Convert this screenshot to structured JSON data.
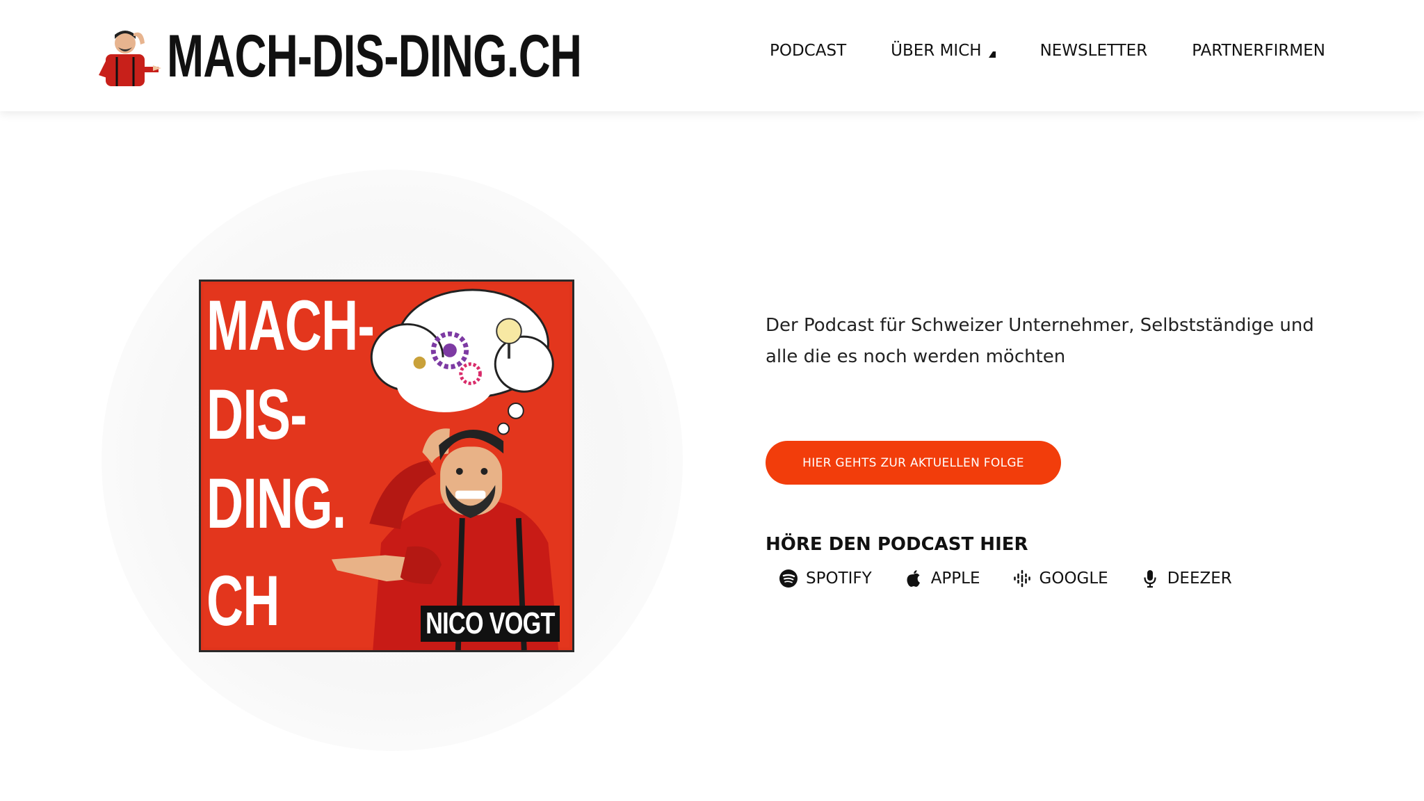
{
  "header": {
    "logo_text": "MACH-DIS-DING.CH",
    "nav": [
      {
        "label": "PODCAST"
      },
      {
        "label": "ÜBER MICH",
        "has_dropdown": true
      },
      {
        "label": "NEWSLETTER"
      },
      {
        "label": "PARTNERFIRMEN"
      }
    ]
  },
  "hero": {
    "cover": {
      "title_lines": [
        "MACH-",
        "DIS-",
        "DING.",
        "CH"
      ],
      "author": "NICO VOGT"
    },
    "tagline": "Der Podcast für Schweizer Unternehmer, Selbstständige und alle die es noch werden möchten",
    "cta_label": "HIER GEHTS ZUR AKTUELLEN FOLGE",
    "listen_title": "HÖRE DEN PODCAST HIER",
    "platforms": [
      {
        "label": "SPOTIFY",
        "icon": "spotify-icon"
      },
      {
        "label": "APPLE",
        "icon": "apple-icon"
      },
      {
        "label": "GOOGLE",
        "icon": "google-podcasts-icon"
      },
      {
        "label": "DEEZER",
        "icon": "microphone-icon"
      }
    ]
  },
  "colors": {
    "accent": "#f23d0b",
    "cover_red": "#e3361d",
    "text": "#111111"
  }
}
